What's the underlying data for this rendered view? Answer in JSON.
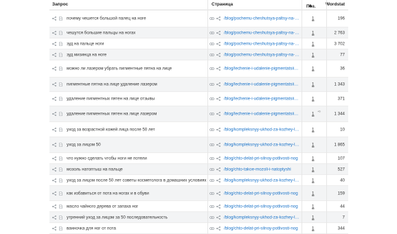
{
  "header": {
    "query": "Запрос",
    "page": "Страница",
    "position": "Поз.",
    "wordstat": "Wordstat"
  },
  "rows": [
    {
      "query": "почему чешется большой палец на ноге",
      "url": "/blog/pochemu-cheshutsya-paltsy-na-n...",
      "pos": "1",
      "change": "",
      "ws": "196",
      "alt": false
    },
    {
      "query": "чешутся большие пальцы на ногах",
      "url": "/blog/pochemu-cheshutsya-paltsy-na-n...",
      "pos": "1",
      "change": "",
      "ws": "2 763",
      "alt": true
    },
    {
      "query": "зуд на пальце ноги",
      "url": "/blog/pochemu-cheshutsya-paltsy-na-n...",
      "pos": "1",
      "change": "",
      "ws": "3 702",
      "alt": false
    },
    {
      "query": "зуд мизинца на ноге",
      "url": "/blog/pochemu-cheshutsya-paltsy-na-n...",
      "pos": "1",
      "change": "",
      "ws": "77",
      "alt": true
    },
    {
      "query": "можно ли лазером убрать пигментные пятна на лице",
      "url": "/blog/lechenie-i-udalenie-pigmentatsii-k...",
      "pos": "1",
      "change": "",
      "ws": "36",
      "alt": false
    },
    {
      "query": "пигментные пятна на лице удаление лазером",
      "url": "/blog/lechenie-i-udalenie-pigmentatsii-k...",
      "pos": "1",
      "change": "",
      "ws": "1 343",
      "alt": true
    },
    {
      "query": "удаление пигментных пятен на лице отзывы",
      "url": "/blog/lechenie-i-udalenie-pigmentatsii-k...",
      "pos": "1",
      "change": "",
      "ws": "371",
      "alt": false
    },
    {
      "query": "удаление пигментных пятен на лице лазером",
      "url": "/blog/lechenie-i-udalenie-pigmentatsii-k...",
      "pos": "1",
      "change": "+6",
      "ws": "1 344",
      "alt": true
    },
    {
      "query": "уход за возрастной кожей лица после 50 лет",
      "url": "/blog/kompleksnyy-ukhod-za-kozhey-lit...",
      "pos": "1",
      "change": "",
      "ws": "10",
      "alt": false
    },
    {
      "query": "уход за лицом 50",
      "url": "/blog/kompleksnyy-ukhod-za-kozhey-lit...",
      "pos": "1",
      "change": "",
      "ws": "1 865",
      "alt": true
    },
    {
      "query": "что нужно сделать чтобы ноги не потели",
      "url": "/blog/chto-delat-pri-silnoy-potlivosti-nog",
      "pos": "1",
      "change": "",
      "ws": "107",
      "alt": false
    },
    {
      "query": "мозоль натоптыш на пальце",
      "url": "/blog/chto-takoe-mozoli-i-natoptyshi",
      "pos": "1",
      "change": "",
      "ws": "527",
      "alt": true
    },
    {
      "query": "уход за лицом после 50 лет советы косметолога в домашних условиях",
      "url": "/blog/kompleksnyy-ukhod-za-kozhey-lit...",
      "pos": "1",
      "change": "",
      "ws": "40",
      "alt": false
    },
    {
      "query": "как избавиться от пота на ногах и в обуви",
      "url": "/blog/chto-delat-pri-silnoy-potlivosti-nog",
      "pos": "1",
      "change": "",
      "ws": "159",
      "alt": true
    },
    {
      "query": "масло чайного дерева от запаха ног",
      "url": "/blog/chto-delat-pri-silnoy-potlivosti-nog",
      "pos": "1",
      "change": "",
      "ws": "44",
      "alt": false
    },
    {
      "query": "утренний уход за лицом за 50 последовательность",
      "url": "/blog/kompleksnyy-ukhod-za-kozhey-lit...",
      "pos": "1",
      "change": "",
      "ws": "7",
      "alt": true
    },
    {
      "query": "ванночка для ног от пота",
      "url": "/blog/chto-delat-pri-silnoy-potlivosti-nog",
      "pos": "1",
      "change": "",
      "ws": "344",
      "alt": false
    }
  ],
  "icons": {
    "share": "share-icon",
    "doc": "document-icon",
    "link": "link-icon",
    "sort": "sort-up-icon"
  },
  "colors": {
    "link": "#1a73c9",
    "alt_row": "#f3f4f5"
  }
}
